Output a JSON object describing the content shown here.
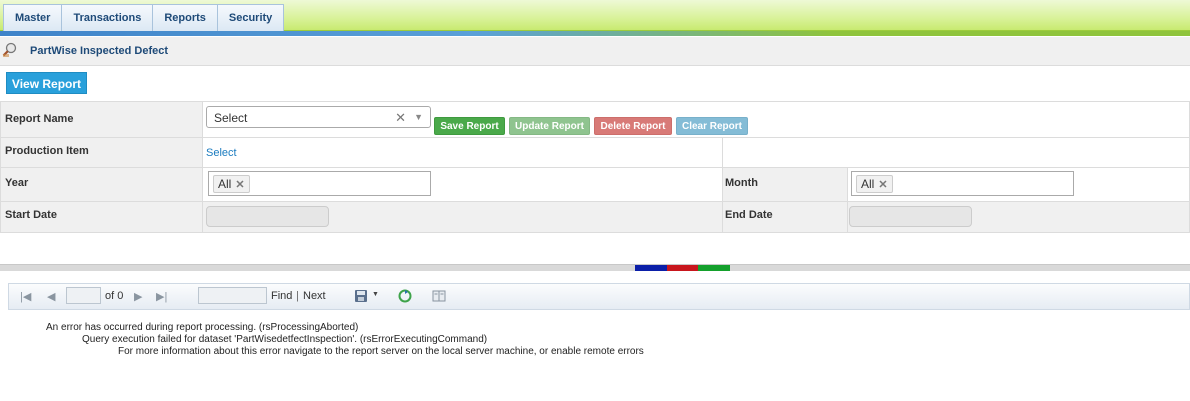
{
  "nav": {
    "tabs": [
      {
        "label": "Master"
      },
      {
        "label": "Transactions"
      },
      {
        "label": "Reports"
      },
      {
        "label": "Security"
      }
    ]
  },
  "page": {
    "title": "PartWise Inspected Defect",
    "title_icon": "magnifier-icon",
    "view_report_label": "View Report"
  },
  "form": {
    "report_name_label": "Report Name",
    "report_name_value": "Select",
    "buttons": {
      "save": "Save Report",
      "update": "Update Report",
      "delete": "Delete Report",
      "clear": "Clear Report"
    },
    "production_item_label": "Production Item",
    "production_item_link": "Select",
    "year_label": "Year",
    "year_chip": "All",
    "month_label": "Month",
    "month_chip": "All",
    "start_date_label": "Start Date",
    "start_date_value": "",
    "end_date_label": "End Date",
    "end_date_value": ""
  },
  "colors": {
    "accent": "#29a0db",
    "save": "#4aa94a",
    "update": "#8fc48f",
    "delete": "#d87a77",
    "clear": "#84bcd6",
    "splitter_marks": [
      "#0b1fa8",
      "#c8161d",
      "#14a02c"
    ]
  },
  "report_viewer": {
    "page_of": "of 0",
    "find": "Find",
    "separator": "|",
    "next": "Next",
    "icons": [
      "first-page-icon",
      "prev-page-icon",
      "next-page-icon",
      "last-page-icon",
      "export-icon",
      "refresh-icon",
      "print-layout-icon"
    ],
    "errors": [
      "An error has occurred during report processing. (rsProcessingAborted)",
      "Query execution failed for dataset 'PartWisedetfectInspection'. (rsErrorExecutingCommand)",
      "For more information about this error navigate to the report server on the local server machine, or enable remote errors"
    ]
  }
}
